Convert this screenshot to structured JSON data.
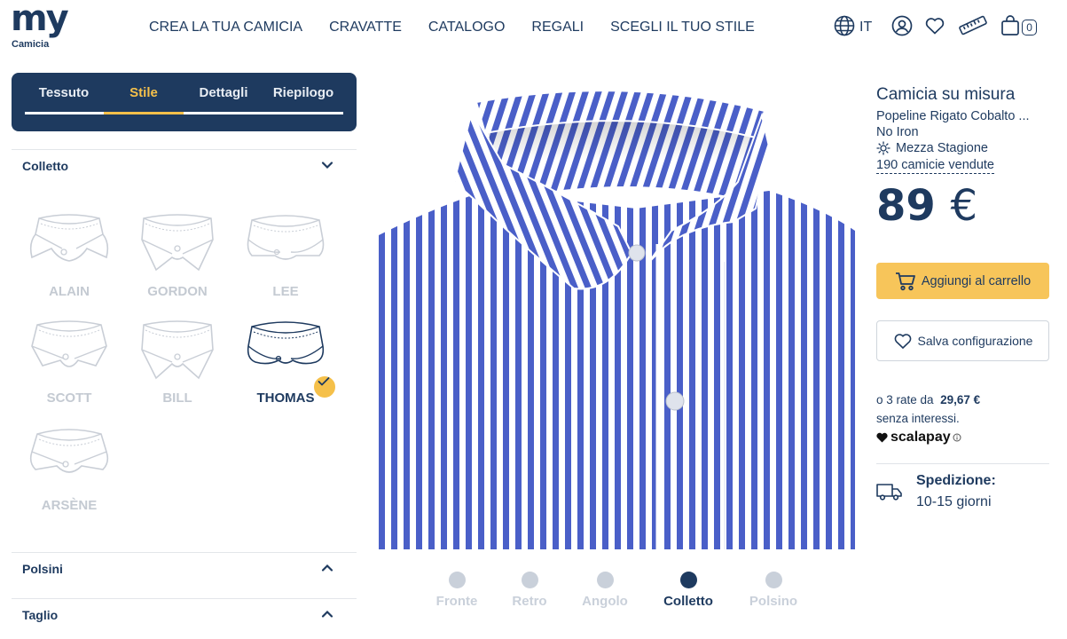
{
  "brand": {
    "logo_main": "my",
    "logo_sub": "Camicia"
  },
  "nav": {
    "items": [
      "CREA LA TUA CAMICIA",
      "CRAVATTE",
      "CATALOGO",
      "REGALI",
      "SCEGLI IL TUO STILE"
    ]
  },
  "tools": {
    "language": "IT",
    "cart_count": "0"
  },
  "tabs": {
    "items": [
      "Tessuto",
      "Stile",
      "Dettagli",
      "Riepilogo"
    ],
    "active": "Stile"
  },
  "sections": {
    "collar": "Colletto",
    "cuffs": "Polsini",
    "fit": "Taglio"
  },
  "collars": {
    "items": [
      "ALAIN",
      "GORDON",
      "LEE",
      "SCOTT",
      "BILL",
      "THOMAS",
      "ARSÈNE"
    ],
    "selected": "THOMAS"
  },
  "views": {
    "items": [
      "Fronte",
      "Retro",
      "Angolo",
      "Colletto",
      "Polsino"
    ],
    "active": "Colletto"
  },
  "product": {
    "title": "Camicia su misura",
    "fabric": "Popeline Rigato Cobalto ...",
    "treatment": "No Iron",
    "season": "Mezza Stagione",
    "sold": "190 camicie vendute",
    "price_value": "89",
    "price_currency": "€",
    "add_to_cart": "Aggiungi al carrello",
    "save_config": "Salva configurazione",
    "installments_prefix": "o 3 rate da",
    "installments_amount": "29,67 €",
    "installments_suffix": "senza interessi.",
    "scalapay": "scalapay",
    "shipping_title": "Spedizione:",
    "shipping_time": "10-15 giorni"
  },
  "colors": {
    "navy": "#1e3a5f",
    "accent": "#f5c04a",
    "muted": "#c4cad2",
    "shirt_stripe": "#4a5fc8"
  }
}
